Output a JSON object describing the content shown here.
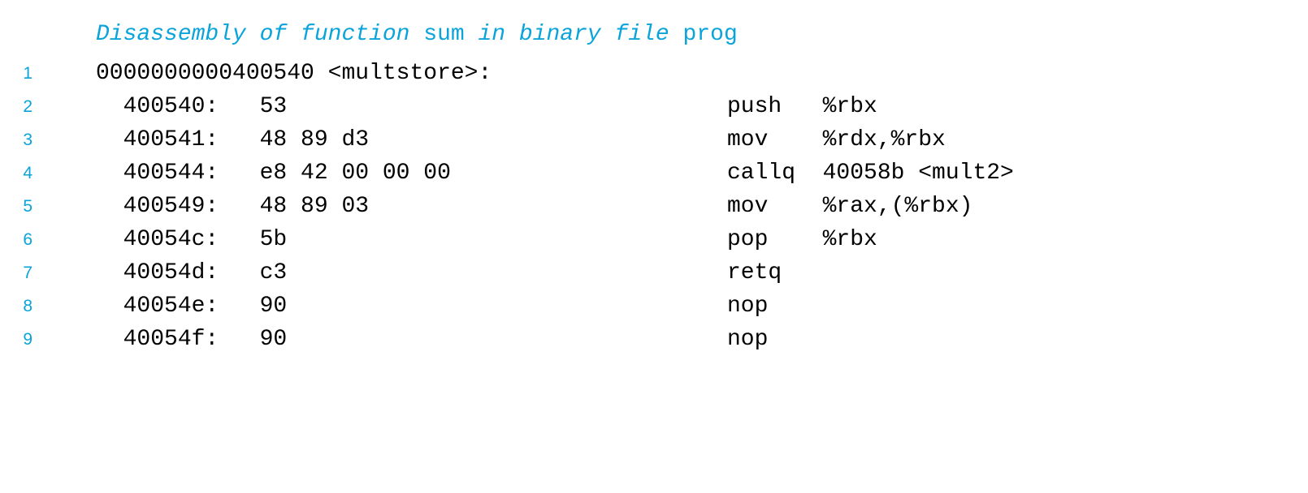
{
  "colors": {
    "accent": "#0aa3da",
    "code_text": "#000000",
    "background": "#ffffff"
  },
  "caption": {
    "segments": [
      {
        "text": "Disassembly of function ",
        "style": "italic"
      },
      {
        "text": "sum",
        "style": "roman"
      },
      {
        "text": " in binary file ",
        "style": "italic"
      },
      {
        "text": "prog",
        "style": "roman"
      }
    ],
    "plain": "Disassembly of function sum in binary file prog"
  },
  "listing": {
    "rows": [
      {
        "lineno": "1",
        "kind": "label",
        "label": "0000000000400540 <multstore>:",
        "address": "",
        "bytes": "",
        "instruction": ""
      },
      {
        "lineno": "2",
        "kind": "instruction",
        "label": "",
        "address": "  400540:",
        "bytes": "53",
        "instruction": "push   %rbx"
      },
      {
        "lineno": "3",
        "kind": "instruction",
        "label": "",
        "address": "  400541:",
        "bytes": "48 89 d3",
        "instruction": "mov    %rdx,%rbx"
      },
      {
        "lineno": "4",
        "kind": "instruction",
        "label": "",
        "address": "  400544:",
        "bytes": "e8 42 00 00 00",
        "instruction": "callq  40058b <mult2>"
      },
      {
        "lineno": "5",
        "kind": "instruction",
        "label": "",
        "address": "  400549:",
        "bytes": "48 89 03",
        "instruction": "mov    %rax,(%rbx)"
      },
      {
        "lineno": "6",
        "kind": "instruction",
        "label": "",
        "address": "  40054c:",
        "bytes": "5b",
        "instruction": "pop    %rbx"
      },
      {
        "lineno": "7",
        "kind": "instruction",
        "label": "",
        "address": "  40054d:",
        "bytes": "c3",
        "instruction": "retq"
      },
      {
        "lineno": "8",
        "kind": "instruction",
        "label": "",
        "address": "  40054e:",
        "bytes": "90",
        "instruction": "nop"
      },
      {
        "lineno": "9",
        "kind": "instruction",
        "label": "",
        "address": "  40054f:",
        "bytes": "90",
        "instruction": "nop"
      }
    ]
  }
}
